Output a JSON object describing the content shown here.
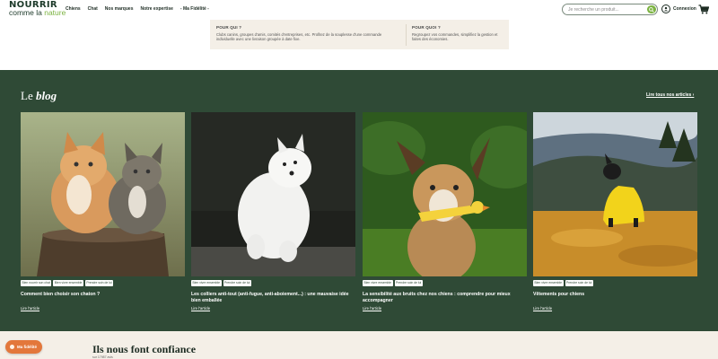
{
  "header": {
    "logo_line1": "NOURRIR",
    "logo_line2_a": "comme la",
    "logo_line2_b": "nature",
    "nav": [
      "Chiens",
      "Chat",
      "Nos marques",
      "Notre expertise",
      "- Ma Fidélité -"
    ],
    "search_placeholder": "Je recherche un produit...",
    "account_label": "Connexion"
  },
  "target_card": {
    "col1_title": "POUR QUI ?",
    "col1_text": "Clubs canins, groupes d'amis, comités d'entreprises, etc. Profitez de la souplesse d'une commande individuelle avec une livraison groupée à date fixe.",
    "col2_title": "POUR QUOI ?",
    "col2_text": "Regroupez vos commandes, simplifiez la gestion et faites des économies."
  },
  "blog": {
    "title_prefix": "Le",
    "title_word": "blog",
    "all_articles": "Lire tous nos articles ›",
    "read_more": "Lire l'article",
    "articles": [
      {
        "tags": [
          "Bien nourrir son chat",
          "Bien vivre ensemble",
          "Prendre soin de lui"
        ],
        "title": "Comment bien choisir son chaton ?",
        "image": "two-kittens-on-tree-stump"
      },
      {
        "tags": [
          "Bien vivre ensemble",
          "Prendre soin de lui"
        ],
        "title": "Les colliers anti-tout (anti-fugue, anti-aboiement...) : une mauvaise idée bien emballée",
        "image": "white-spitz-dog"
      },
      {
        "tags": [
          "Bien vivre ensemble",
          "Prendre soin de lui"
        ],
        "title": "La sensibilité aux bruits chez nos chiens : comprendre pour mieux accompagner",
        "image": "dog-with-rubber-chicken"
      },
      {
        "tags": [
          "Bien vivre ensemble",
          "Prendre soin de lui"
        ],
        "title": "Vêtements pour chiens",
        "image": "dog-in-yellow-raincoat"
      }
    ]
  },
  "trust": {
    "title": "Ils nous font confiance",
    "subtitle": "sur 17987 avis"
  },
  "fidelity_button": "Ma fidélité",
  "colors": {
    "brand_green": "#2f4a36",
    "accent_green": "#7cb342",
    "beige": "#f4efe7",
    "orange": "#e3773b"
  }
}
